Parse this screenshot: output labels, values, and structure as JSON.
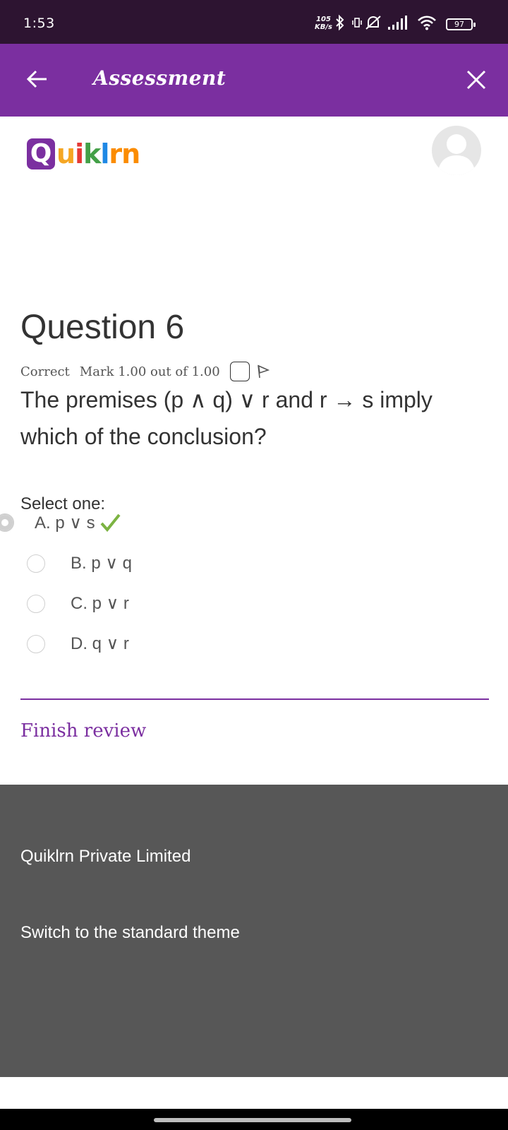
{
  "status_bar": {
    "time": "1:53",
    "speed_value": "105",
    "speed_unit": "KB/s",
    "battery": "97",
    "icons": [
      "bluetooth-icon",
      "vibrate-icon",
      "mute-icon",
      "signal-icon",
      "wifi-icon",
      "battery-icon"
    ]
  },
  "app_bar": {
    "title": "Assessment",
    "background": "#7b2fa0",
    "back_icon": "arrow-left-icon",
    "close_icon": "close-icon"
  },
  "header": {
    "logo_letter": "Q",
    "logo_rest": [
      {
        "ch": "u",
        "color": "#f5a623"
      },
      {
        "ch": "i",
        "color": "#e53935"
      },
      {
        "ch": "k",
        "color": "#43a047"
      },
      {
        "ch": "l",
        "color": "#1e88e5"
      },
      {
        "ch": "r",
        "color": "#fb8c00"
      },
      {
        "ch": "n",
        "color": "#fb8c00"
      }
    ],
    "avatar_icon": "user-avatar-icon"
  },
  "question": {
    "title": "Question 6",
    "state": "Correct",
    "mark": "Mark 1.00 out of 1.00",
    "text": "The premises (p ∧ q) ∨ r and r → s imply which of the conclusion?",
    "select_label": "Select one:",
    "options": [
      {
        "label": "A. p ∨ s",
        "selected": true,
        "correct": true
      },
      {
        "label": "B. p ∨ q",
        "selected": false
      },
      {
        "label": "C. p ∨ r",
        "selected": false
      },
      {
        "label": "D. q ∨ r",
        "selected": false
      }
    ]
  },
  "actions": {
    "finish_review": "Finish review"
  },
  "footer": {
    "company": "Quiklrn Private Limited",
    "theme_link": "Switch to the standard theme"
  }
}
